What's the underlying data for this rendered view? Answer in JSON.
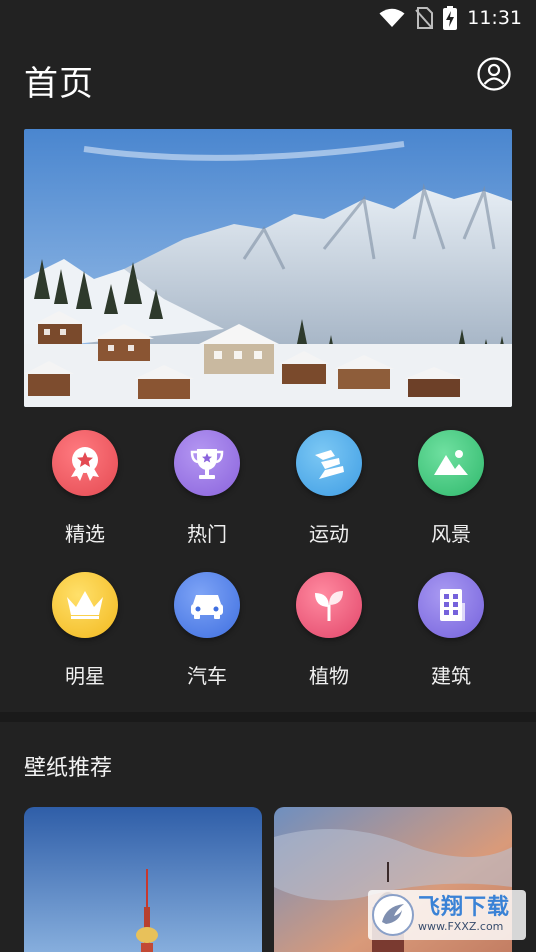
{
  "status_bar": {
    "time": "11:31",
    "icons": [
      "wifi-icon",
      "no-sim-icon",
      "battery-charging-icon"
    ]
  },
  "header": {
    "title": "首页",
    "profile_icon": "user-circle-icon"
  },
  "categories": [
    {
      "label": "精选",
      "icon": "badge-star-icon",
      "color": "#ef5b62"
    },
    {
      "label": "热门",
      "icon": "trophy-icon",
      "color": "#9b77e6"
    },
    {
      "label": "运动",
      "icon": "runner-icon",
      "color": "#4aa8e8"
    },
    {
      "label": "风景",
      "icon": "mountain-icon",
      "color": "#3fc77d"
    },
    {
      "label": "明星",
      "icon": "crown-icon",
      "color": "#f6c531"
    },
    {
      "label": "汽车",
      "icon": "car-icon",
      "color": "#4f7fe8"
    },
    {
      "label": "植物",
      "icon": "sprout-icon",
      "color": "#ee5e7c"
    },
    {
      "label": "建筑",
      "icon": "building-icon",
      "color": "#8a7ce8"
    }
  ],
  "section": {
    "title": "壁纸推荐"
  },
  "watermark": {
    "title": "飞翔下载",
    "url": "www.FXXZ.com"
  }
}
